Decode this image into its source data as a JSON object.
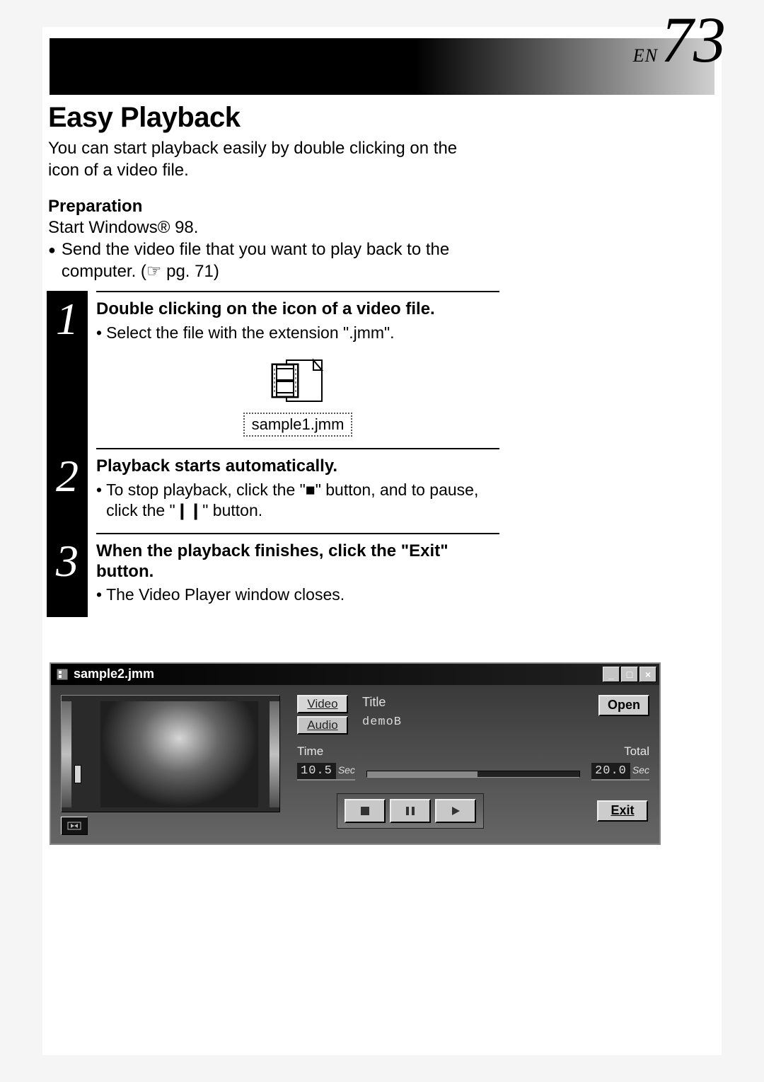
{
  "header": {
    "lang": "EN",
    "page": "73"
  },
  "title": "Easy Playback",
  "intro": "You can start playback easily by double clicking on the icon of a video file.",
  "prep": {
    "heading": "Preparation",
    "line1": "Start Windows® 98.",
    "bullet": "Send the video file that you want to play back to the computer. (☞ pg. 71)"
  },
  "steps": [
    {
      "num": "1",
      "heading": "Double clicking on the icon of a video file.",
      "bullet": "Select the file with the extension \".jmm\".",
      "file_label": "sample1.jmm"
    },
    {
      "num": "2",
      "heading": "Playback starts automatically.",
      "bullet": "To stop playback, click the \"■\" button, and to pause, click the \"❙❙\" button."
    },
    {
      "num": "3",
      "heading": "When the playback finishes, click the \"Exit\" button.",
      "bullet": "The Video Player window closes."
    }
  ],
  "player": {
    "window_title": "sample2.jmm",
    "tab_video": "Video",
    "tab_audio": "Audio",
    "title_label": "Title",
    "title_value": "demoB",
    "open_label": "Open",
    "time_label": "Time",
    "time_value": "10.5",
    "sec": "Sec",
    "total_label": "Total",
    "total_value": "20.0",
    "exit_label": "Exit",
    "min_btn": "_",
    "max_btn": "□",
    "close_btn": "×"
  }
}
